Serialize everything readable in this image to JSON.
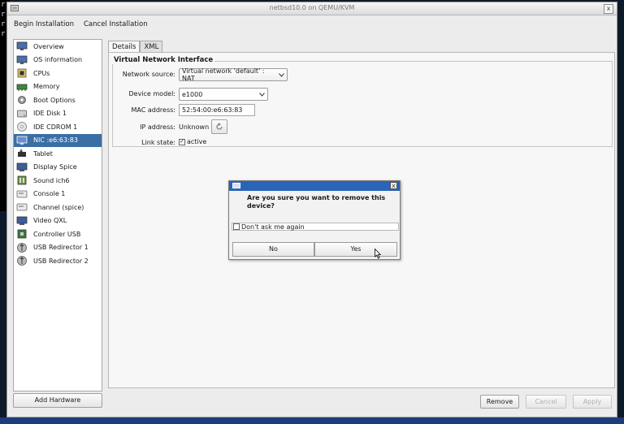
{
  "window": {
    "title": "netbsd10.0 on QEMU/KVM",
    "close_glyph": "x"
  },
  "terminal": {
    "lines": [
      "r",
      "r",
      "r",
      "r"
    ]
  },
  "menubar": {
    "begin_label": "Begin Installation",
    "cancel_label": "Cancel Installation"
  },
  "sidebar": {
    "items": [
      {
        "label": "Overview",
        "icon": "monitor-icon"
      },
      {
        "label": "OS information",
        "icon": "monitor-icon"
      },
      {
        "label": "CPUs",
        "icon": "cpu-icon"
      },
      {
        "label": "Memory",
        "icon": "memory-icon"
      },
      {
        "label": "Boot Options",
        "icon": "gear-icon"
      },
      {
        "label": "IDE Disk 1",
        "icon": "disk-icon"
      },
      {
        "label": "IDE CDROM 1",
        "icon": "cdrom-icon"
      },
      {
        "label": "NIC :e6:63:83",
        "icon": "network-icon",
        "selected": true
      },
      {
        "label": "Tablet",
        "icon": "tablet-icon"
      },
      {
        "label": "Display Spice",
        "icon": "display-icon"
      },
      {
        "label": "Sound ich6",
        "icon": "sound-icon"
      },
      {
        "label": "Console 1",
        "icon": "console-icon"
      },
      {
        "label": "Channel (spice)",
        "icon": "console-icon"
      },
      {
        "label": "Video QXL",
        "icon": "display-icon"
      },
      {
        "label": "Controller USB",
        "icon": "controller-icon"
      },
      {
        "label": "USB Redirector 1",
        "icon": "usb-icon"
      },
      {
        "label": "USB Redirector 2",
        "icon": "usb-icon"
      }
    ],
    "add_hardware_label": "Add Hardware"
  },
  "tabs": [
    {
      "label": "Details",
      "active": true
    },
    {
      "label": "XML",
      "active": false
    }
  ],
  "details": {
    "section_title": "Virtual Network Interface",
    "network_source_label": "Network source:",
    "network_source_value": "Virtual network 'default' : NAT",
    "device_model_label": "Device model:",
    "device_model_value": "e1000",
    "mac_label": "MAC address:",
    "mac_value": "52:54:00:e6:63:83",
    "ip_label": "IP address:",
    "ip_value": "Unknown",
    "link_label": "Link state:",
    "link_value": "active",
    "link_checked": true
  },
  "footer": {
    "remove_label": "Remove",
    "cancel_label": "Cancel",
    "apply_label": "Apply"
  },
  "dialog": {
    "message": "Are you sure you want to remove this device?",
    "checkbox_label": "Don't ask me again",
    "no_label": "No",
    "yes_label": "Yes",
    "close_glyph": "x"
  },
  "colors": {
    "selection": "#3a6ea5",
    "dialog_titlebar": "#2a64b8",
    "desktop": "#1d3c7a"
  }
}
